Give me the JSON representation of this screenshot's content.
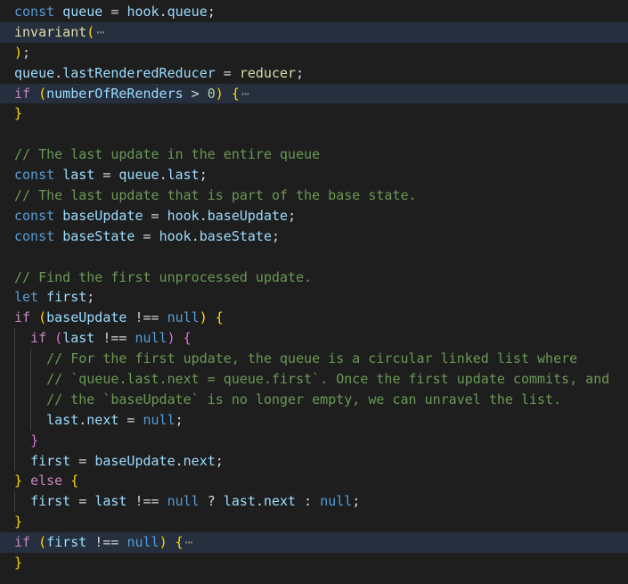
{
  "editor": {
    "lines": [
      {
        "folded": false,
        "indent": 0,
        "tokens": [
          [
            "kw",
            "const"
          ],
          [
            "op",
            " "
          ],
          [
            "var",
            "queue"
          ],
          [
            "op",
            " = "
          ],
          [
            "var",
            "hook"
          ],
          [
            "op",
            "."
          ],
          [
            "var",
            "queue"
          ],
          [
            "op",
            ";"
          ]
        ]
      },
      {
        "folded": true,
        "indent": 0,
        "tokens": [
          [
            "fn",
            "invariant"
          ],
          [
            "br1",
            "("
          ]
        ]
      },
      {
        "folded": false,
        "indent": 0,
        "tokens": [
          [
            "br1",
            ")"
          ],
          [
            "op",
            ";"
          ]
        ]
      },
      {
        "folded": false,
        "indent": 0,
        "tokens": [
          [
            "var",
            "queue"
          ],
          [
            "op",
            "."
          ],
          [
            "var",
            "lastRenderedReducer"
          ],
          [
            "op",
            " = "
          ],
          [
            "fn",
            "reducer"
          ],
          [
            "op",
            ";"
          ]
        ]
      },
      {
        "folded": true,
        "indent": 0,
        "tokens": [
          [
            "ctl",
            "if"
          ],
          [
            "op",
            " "
          ],
          [
            "br1",
            "("
          ],
          [
            "var",
            "numberOfReRenders"
          ],
          [
            "op",
            " > "
          ],
          [
            "num",
            "0"
          ],
          [
            "br1",
            ")"
          ],
          [
            "op",
            " "
          ],
          [
            "br1",
            "{"
          ]
        ]
      },
      {
        "folded": false,
        "indent": 0,
        "tokens": [
          [
            "br1",
            "}"
          ]
        ]
      },
      {
        "folded": false,
        "indent": 0,
        "tokens": []
      },
      {
        "folded": false,
        "indent": 0,
        "tokens": [
          [
            "cm",
            "// The last update in the entire queue"
          ]
        ]
      },
      {
        "folded": false,
        "indent": 0,
        "tokens": [
          [
            "kw",
            "const"
          ],
          [
            "op",
            " "
          ],
          [
            "var",
            "last"
          ],
          [
            "op",
            " = "
          ],
          [
            "var",
            "queue"
          ],
          [
            "op",
            "."
          ],
          [
            "var",
            "last"
          ],
          [
            "op",
            ";"
          ]
        ]
      },
      {
        "folded": false,
        "indent": 0,
        "tokens": [
          [
            "cm",
            "// The last update that is part of the base state."
          ]
        ]
      },
      {
        "folded": false,
        "indent": 0,
        "tokens": [
          [
            "kw",
            "const"
          ],
          [
            "op",
            " "
          ],
          [
            "var",
            "baseUpdate"
          ],
          [
            "op",
            " = "
          ],
          [
            "var",
            "hook"
          ],
          [
            "op",
            "."
          ],
          [
            "var",
            "baseUpdate"
          ],
          [
            "op",
            ";"
          ]
        ]
      },
      {
        "folded": false,
        "indent": 0,
        "tokens": [
          [
            "kw",
            "const"
          ],
          [
            "op",
            " "
          ],
          [
            "var",
            "baseState"
          ],
          [
            "op",
            " = "
          ],
          [
            "var",
            "hook"
          ],
          [
            "op",
            "."
          ],
          [
            "var",
            "baseState"
          ],
          [
            "op",
            ";"
          ]
        ]
      },
      {
        "folded": false,
        "indent": 0,
        "tokens": []
      },
      {
        "folded": false,
        "indent": 0,
        "tokens": [
          [
            "cm",
            "// Find the first unprocessed update."
          ]
        ]
      },
      {
        "folded": false,
        "indent": 0,
        "tokens": [
          [
            "kw",
            "let"
          ],
          [
            "op",
            " "
          ],
          [
            "var",
            "first"
          ],
          [
            "op",
            ";"
          ]
        ]
      },
      {
        "folded": false,
        "indent": 0,
        "tokens": [
          [
            "ctl",
            "if"
          ],
          [
            "op",
            " "
          ],
          [
            "br1",
            "("
          ],
          [
            "var",
            "baseUpdate"
          ],
          [
            "op",
            " !== "
          ],
          [
            "kw",
            "null"
          ],
          [
            "br1",
            ")"
          ],
          [
            "op",
            " "
          ],
          [
            "br1",
            "{"
          ]
        ]
      },
      {
        "folded": false,
        "indent": 1,
        "tokens": [
          [
            "ctl",
            "if"
          ],
          [
            "op",
            " "
          ],
          [
            "br2",
            "("
          ],
          [
            "var",
            "last"
          ],
          [
            "op",
            " !== "
          ],
          [
            "kw",
            "null"
          ],
          [
            "br2",
            ")"
          ],
          [
            "op",
            " "
          ],
          [
            "br2",
            "{"
          ]
        ]
      },
      {
        "folded": false,
        "indent": 2,
        "tokens": [
          [
            "cm",
            "// For the first update, the queue is a circular linked list where"
          ]
        ]
      },
      {
        "folded": false,
        "indent": 2,
        "tokens": [
          [
            "cm",
            "// `queue.last.next = queue.first`. Once the first update commits, and"
          ]
        ]
      },
      {
        "folded": false,
        "indent": 2,
        "tokens": [
          [
            "cm",
            "// the `baseUpdate` is no longer empty, we can unravel the list."
          ]
        ]
      },
      {
        "folded": false,
        "indent": 2,
        "tokens": [
          [
            "var",
            "last"
          ],
          [
            "op",
            "."
          ],
          [
            "var",
            "next"
          ],
          [
            "op",
            " = "
          ],
          [
            "kw",
            "null"
          ],
          [
            "op",
            ";"
          ]
        ]
      },
      {
        "folded": false,
        "indent": 1,
        "tokens": [
          [
            "br2",
            "}"
          ]
        ]
      },
      {
        "folded": false,
        "indent": 1,
        "tokens": [
          [
            "var",
            "first"
          ],
          [
            "op",
            " = "
          ],
          [
            "var",
            "baseUpdate"
          ],
          [
            "op",
            "."
          ],
          [
            "var",
            "next"
          ],
          [
            "op",
            ";"
          ]
        ]
      },
      {
        "folded": false,
        "indent": 0,
        "tokens": [
          [
            "br1",
            "}"
          ],
          [
            "op",
            " "
          ],
          [
            "ctl",
            "else"
          ],
          [
            "op",
            " "
          ],
          [
            "br1",
            "{"
          ]
        ]
      },
      {
        "folded": false,
        "indent": 1,
        "tokens": [
          [
            "var",
            "first"
          ],
          [
            "op",
            " = "
          ],
          [
            "var",
            "last"
          ],
          [
            "op",
            " !== "
          ],
          [
            "kw",
            "null"
          ],
          [
            "op",
            " ? "
          ],
          [
            "var",
            "last"
          ],
          [
            "op",
            "."
          ],
          [
            "var",
            "next"
          ],
          [
            "op",
            " : "
          ],
          [
            "kw",
            "null"
          ],
          [
            "op",
            ";"
          ]
        ]
      },
      {
        "folded": false,
        "indent": 0,
        "tokens": [
          [
            "br1",
            "}"
          ]
        ]
      },
      {
        "folded": true,
        "indent": 0,
        "tokens": [
          [
            "ctl",
            "if"
          ],
          [
            "op",
            " "
          ],
          [
            "br1",
            "("
          ],
          [
            "var",
            "first"
          ],
          [
            "op",
            " !== "
          ],
          [
            "kw",
            "null"
          ],
          [
            "br1",
            ")"
          ],
          [
            "op",
            " "
          ],
          [
            "br1",
            "{"
          ]
        ]
      },
      {
        "folded": false,
        "indent": 0,
        "tokens": [
          [
            "br1",
            "}"
          ]
        ]
      }
    ],
    "fold_ellipsis": "⋯"
  },
  "colors": {
    "background": "#1e1e1e",
    "folded_line_highlight": "#252f3d",
    "keyword": "#569cd6",
    "control": "#c586c0",
    "variable": "#9cdcfe",
    "function": "#dcdcaa",
    "number": "#b5cea8",
    "comment": "#6a9955",
    "bracket_level1": "#ffd700",
    "bracket_level2": "#da70d6"
  }
}
